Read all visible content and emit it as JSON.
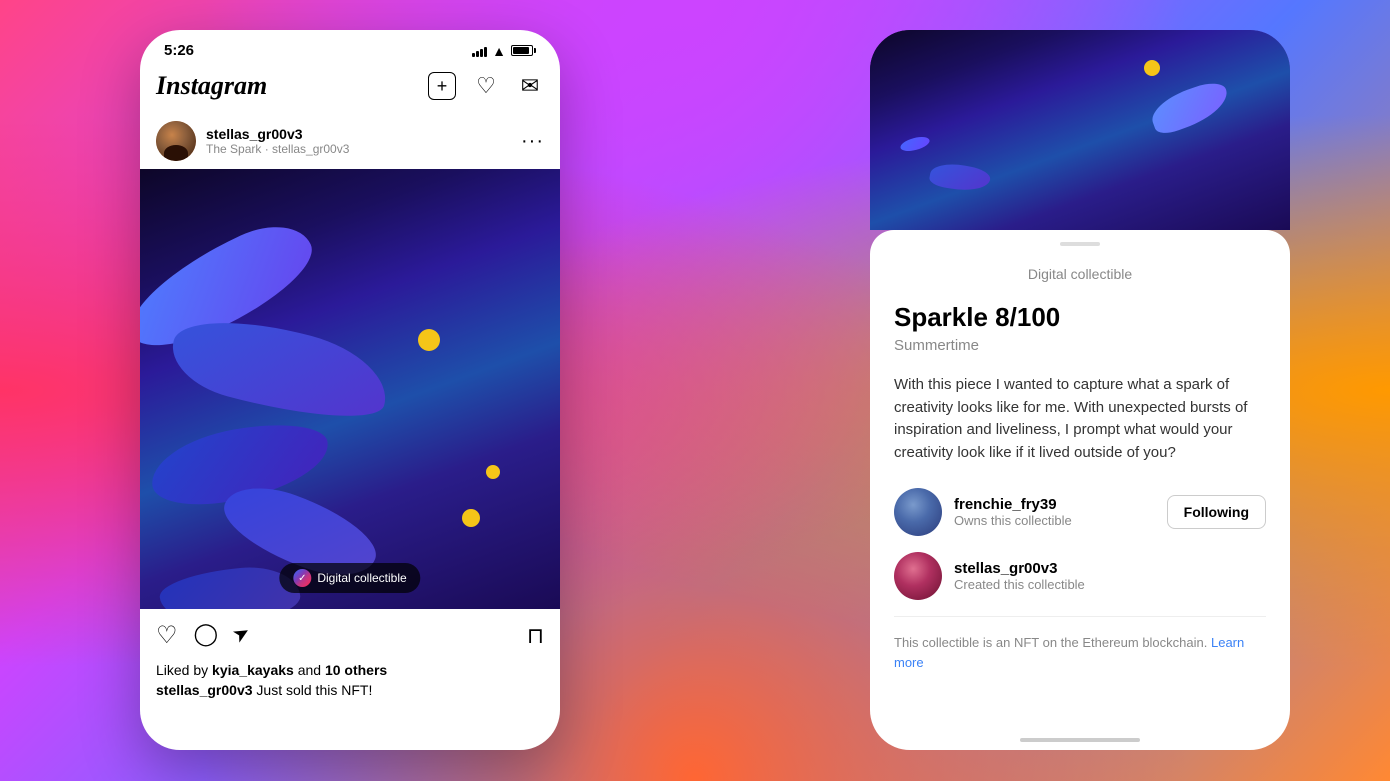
{
  "background": {
    "gradient_description": "instagram-gradient-pink-orange-purple"
  },
  "phone_left": {
    "status_bar": {
      "time": "5:26"
    },
    "header": {
      "logo": "Instagram",
      "icons": [
        "plus-square",
        "heart",
        "messenger"
      ]
    },
    "post": {
      "username": "stellas_gr00v3",
      "subtitle": "The Spark · stellas_gr00v3",
      "more_button": "···",
      "image_alt": "Abstract 3D blue swirls digital art",
      "badge_label": "Digital collectible",
      "actions": {
        "like": "♡",
        "comment": "◯",
        "share": "➤",
        "save": "🔖"
      },
      "likes_text": "Liked by kyia_kayaks and 10 others",
      "caption_username": "stellas_gr00v3",
      "caption_text": "Just sold this NFT!"
    }
  },
  "phone_right": {
    "sheet": {
      "handle": true,
      "title": "Digital collectible",
      "nft_title": "Sparkle 8/100",
      "nft_subtitle": "Summertime",
      "description": "With this piece I wanted to capture what a spark of creativity looks like for me. With unexpected bursts of inspiration and liveliness, I prompt what would your creativity look like if it lived outside of you?",
      "owner": {
        "username": "frenchie_fry39",
        "role": "Owns this collectible",
        "following_label": "Following"
      },
      "creator": {
        "username": "stellas_gr00v3",
        "role": "Created this collectible"
      },
      "blockchain_text": "This collectible is an NFT on the Ethereum blockchain.",
      "learn_more_label": "Learn more"
    }
  }
}
